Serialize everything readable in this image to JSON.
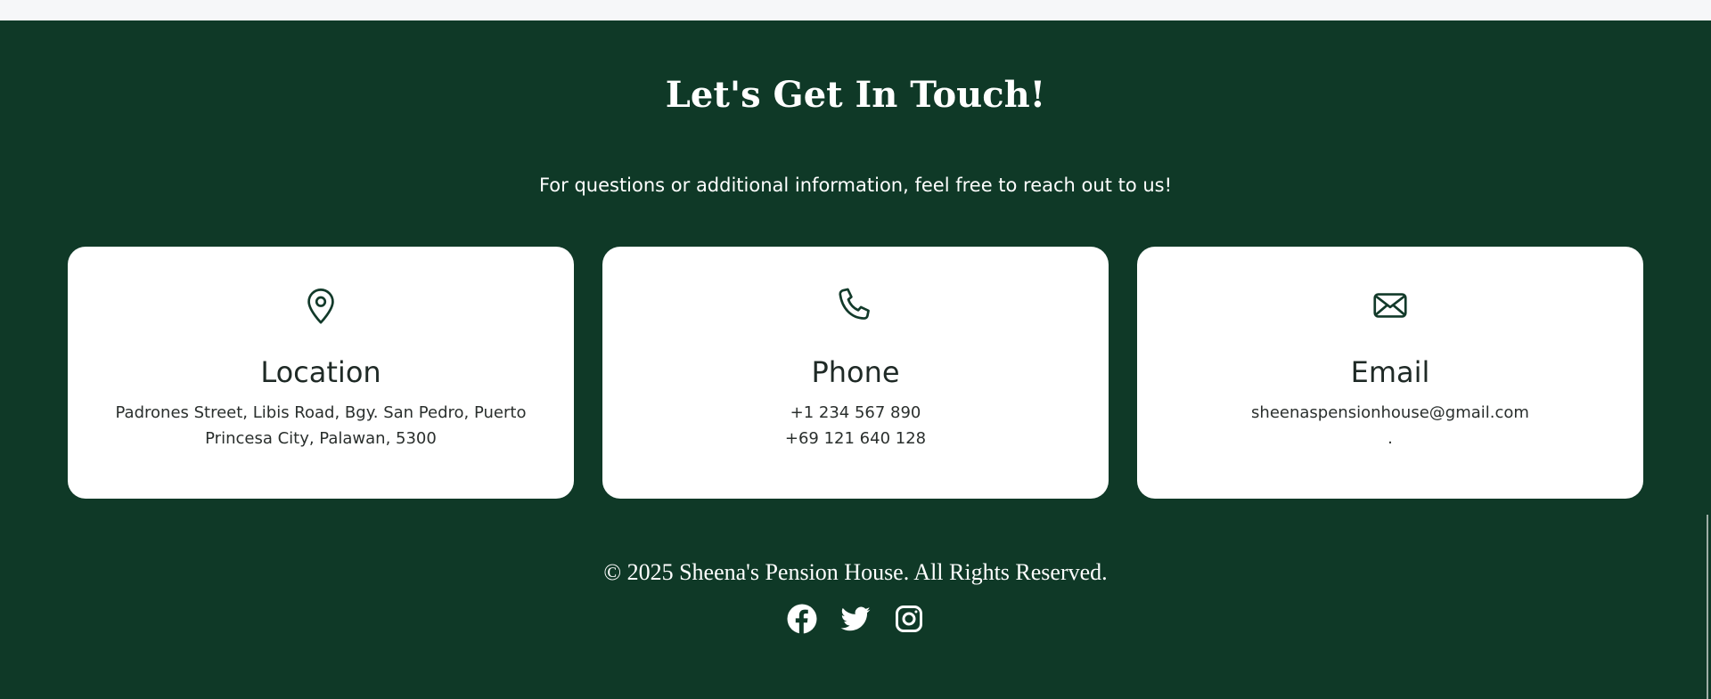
{
  "contact": {
    "heading": "Let's Get In Touch!",
    "subheading": "For questions or additional information, feel free to reach out to us!"
  },
  "cards": [
    {
      "icon": "location-pin-icon",
      "title": "Location",
      "lines": [
        "Padrones Street, Libis Road, Bgy. San Pedro, Puerto",
        "Princesa City, Palawan, 5300"
      ]
    },
    {
      "icon": "phone-icon",
      "title": "Phone",
      "lines": [
        "+1 234 567 890",
        "+69 121 640 128"
      ]
    },
    {
      "icon": "envelope-icon",
      "title": "Email",
      "lines": [
        "sheenaspensionhouse@gmail.com",
        "."
      ]
    }
  ],
  "footer": {
    "copyright": "© 2025 Sheena's Pension House. All Rights Reserved.",
    "socials": [
      "facebook-icon",
      "twitter-icon",
      "instagram-icon"
    ]
  },
  "colors": {
    "background": "#0f3927",
    "card": "#ffffff",
    "icon": "#123a2a",
    "text_light": "#ffffff",
    "text_dark": "#1f2a26"
  }
}
